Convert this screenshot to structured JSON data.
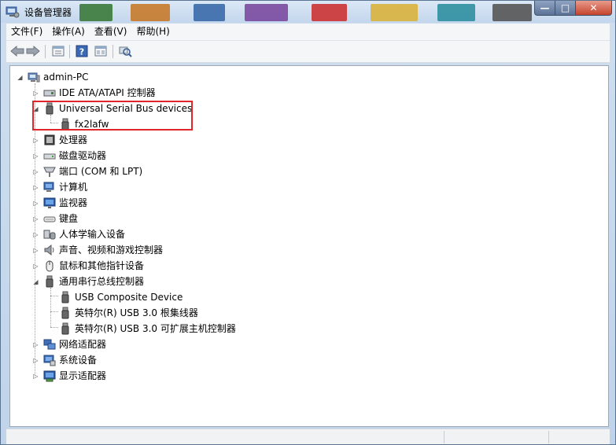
{
  "window": {
    "title": "设备管理器",
    "buttons": {
      "minimize": "—",
      "maximize": "□",
      "close": "✕"
    }
  },
  "menu": [
    "文件(F)",
    "操作(A)",
    "查看(V)",
    "帮助(H)"
  ],
  "toolbar": [
    "back-arrow-icon",
    "forward-arrow-icon",
    "properties-icon",
    "help-icon",
    "show-hide-icon",
    "scan-hardware-icon"
  ],
  "tree": {
    "root": "admin-PC",
    "items": [
      {
        "label": "IDE ATA/ATAPI 控制器",
        "icon": "ide-controller-icon",
        "expanded": false
      },
      {
        "label": "Universal Serial Bus devices",
        "icon": "usb-device-icon",
        "expanded": true,
        "highlighted": true,
        "children": [
          "fx2lafw"
        ]
      },
      {
        "label": "处理器",
        "icon": "processor-icon",
        "expanded": false
      },
      {
        "label": "磁盘驱动器",
        "icon": "disk-drive-icon",
        "expanded": false
      },
      {
        "label": "端口 (COM 和 LPT)",
        "icon": "port-icon",
        "expanded": false
      },
      {
        "label": "计算机",
        "icon": "computer-icon",
        "expanded": false
      },
      {
        "label": "监视器",
        "icon": "monitor-icon",
        "expanded": false
      },
      {
        "label": "键盘",
        "icon": "keyboard-icon",
        "expanded": false
      },
      {
        "label": "人体学输入设备",
        "icon": "hid-icon",
        "expanded": false
      },
      {
        "label": "声音、视频和游戏控制器",
        "icon": "sound-icon",
        "expanded": false
      },
      {
        "label": "鼠标和其他指针设备",
        "icon": "mouse-icon",
        "expanded": false
      },
      {
        "label": "通用串行总线控制器",
        "icon": "usb-device-icon",
        "expanded": true,
        "children": [
          "USB Composite Device",
          "英特尔(R) USB 3.0 根集线器",
          "英特尔(R) USB 3.0 可扩展主机控制器"
        ]
      },
      {
        "label": "网络适配器",
        "icon": "network-icon",
        "expanded": false
      },
      {
        "label": "系统设备",
        "icon": "system-icon",
        "expanded": false
      },
      {
        "label": "显示适配器",
        "icon": "display-adapter-icon",
        "expanded": false
      }
    ]
  },
  "colors": {
    "highlight_border": "#e0262a",
    "window_frame": "#bfd3ea",
    "close_button": "#c4442c"
  }
}
